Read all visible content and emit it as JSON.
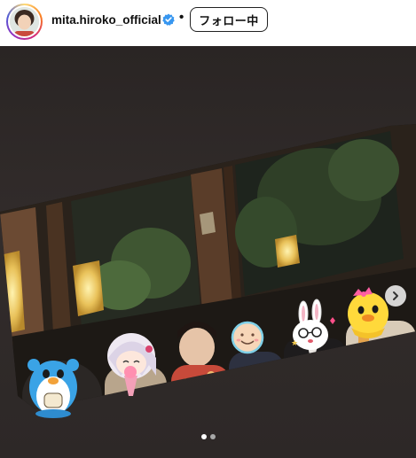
{
  "header": {
    "username": "mita.hiroko_official",
    "separator": "•",
    "follow_label": "フォロー中"
  },
  "media": {
    "slide_count": 2,
    "active_slide": 1
  },
  "colors": {
    "verified_badge": "#3897f0",
    "follow_border": "#222222",
    "media_background": "#2f2a29"
  },
  "icons": {
    "verified": "verified-badge-icon",
    "next": "chevron-right-icon"
  }
}
